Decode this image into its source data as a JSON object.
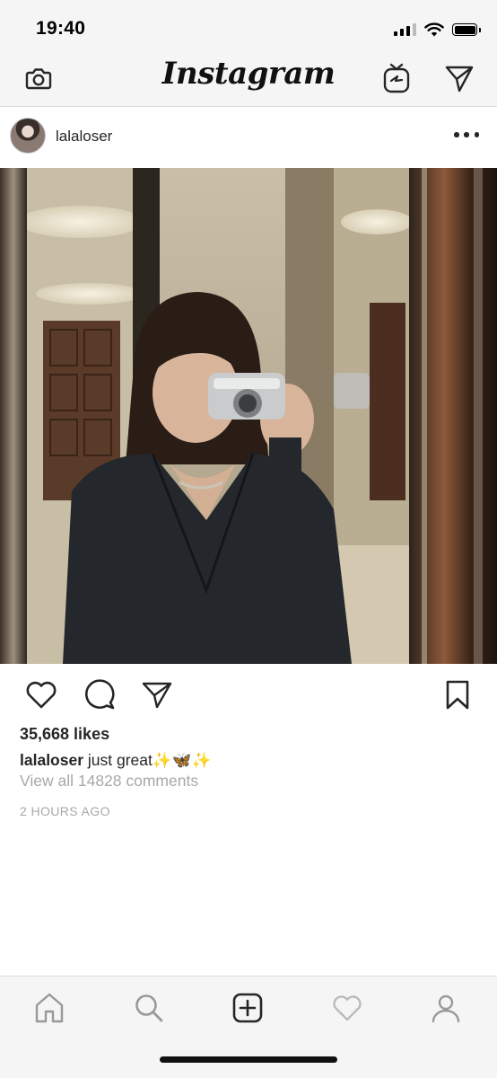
{
  "status_bar": {
    "time": "19:40",
    "icons": [
      "cellular-signal-icon",
      "wifi-icon",
      "battery-icon"
    ]
  },
  "top_nav": {
    "logo": "Instagram",
    "left_icon": "camera-icon",
    "right_icons": [
      "igtv-icon",
      "direct-message-icon"
    ]
  },
  "post": {
    "username": "lalaloser",
    "more_icon": "more-options-icon",
    "image_description_icon": "post-photo",
    "likes": "35,668 likes",
    "caption_user": "lalaloser",
    "caption_text": " just great",
    "caption_emoji": "✨🦋✨",
    "view_comments": "View all 14828 comments",
    "timestamp": "2 HOURS AGO",
    "actions": [
      "heart-icon",
      "comment-icon",
      "share-icon",
      "bookmark-icon"
    ]
  },
  "bottom_nav": {
    "tabs": [
      "home-icon",
      "search-icon",
      "new-post-icon",
      "activity-heart-icon",
      "profile-icon"
    ]
  },
  "colors": {
    "text": "#262626",
    "muted": "#a8a8a8",
    "bar_background": "#f5f5f5",
    "divider": "#dcdcdc"
  }
}
